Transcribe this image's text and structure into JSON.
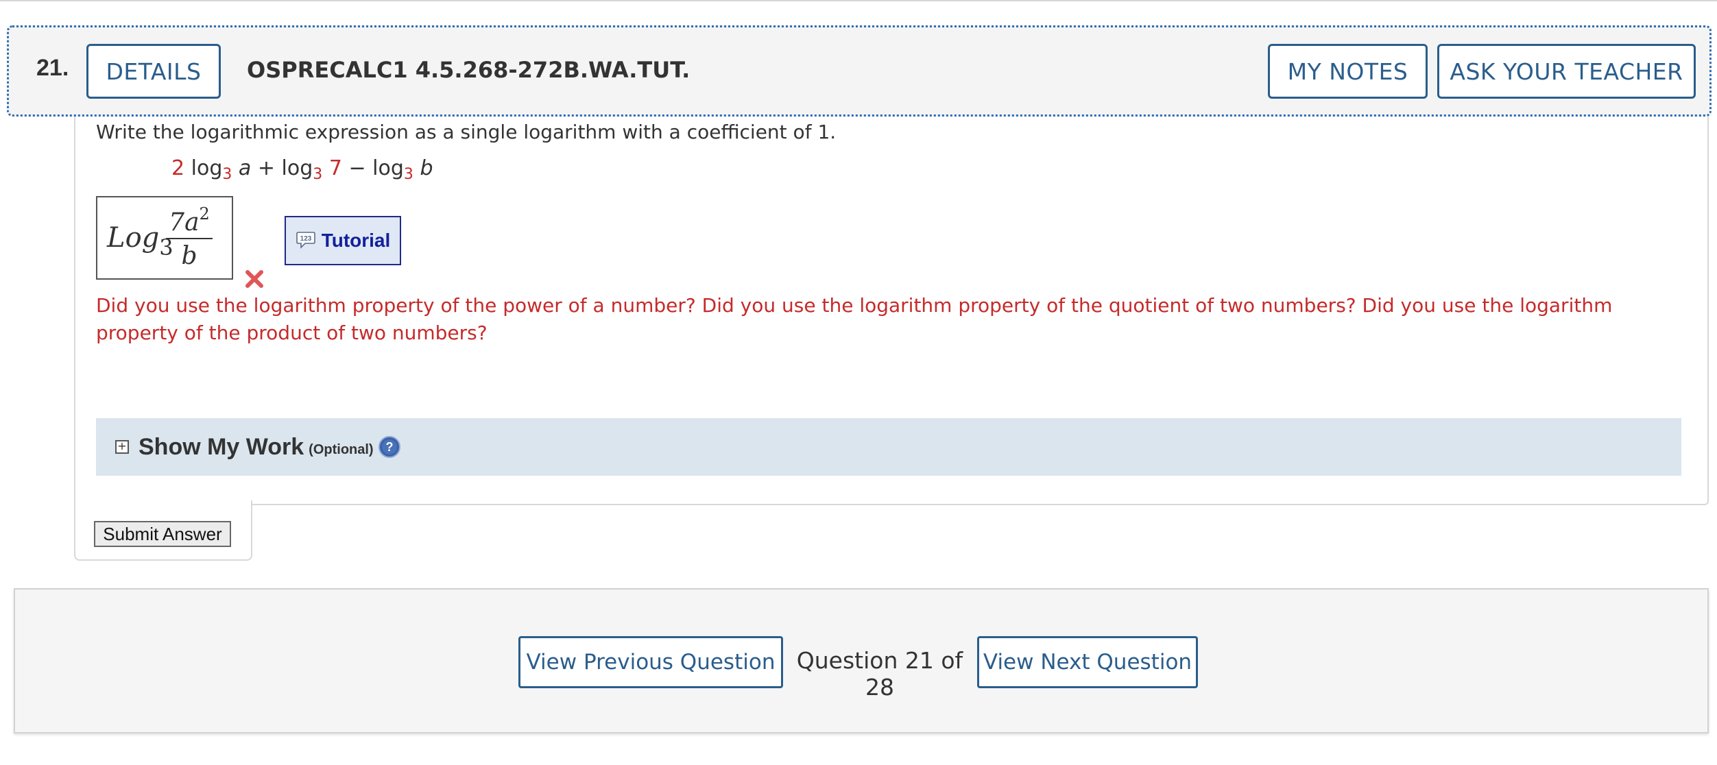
{
  "header": {
    "question_number": "21.",
    "details_label": "DETAILS",
    "question_code": "OSPRECALC1 4.5.268-272B.WA.TUT.",
    "my_notes_label": "MY NOTES",
    "ask_teacher_label": "ASK YOUR TEACHER"
  },
  "question": {
    "instructions": "Write the logarithmic expression as a single logarithm with a coefficient of 1.",
    "expression": {
      "coef": "2",
      "log1": "log",
      "base1": "3",
      "var1": "a",
      "plus": "+",
      "log2": "log",
      "base2": "3",
      "arg2": "7",
      "minus": "−",
      "log3": "log",
      "base3": "3",
      "var3": "b"
    }
  },
  "answer": {
    "log_text": "Log",
    "base": "3",
    "numerator": "7a",
    "exponent": "2",
    "denominator": "b",
    "status": "incorrect",
    "mark_color": "#e05555"
  },
  "tutorial": {
    "label": "Tutorial",
    "icon_text": "123"
  },
  "feedback": {
    "text": "Did you use the logarithm property of the power of a number? Did you use the logarithm property of the quotient of two numbers? Did you use the logarithm property of the product of two numbers?",
    "color": "#c62a2a"
  },
  "show_my_work": {
    "toggle": "+",
    "title": "Show My Work",
    "optional": "(Optional)",
    "help_icon": "question-mark-icon"
  },
  "submit": {
    "label": "Submit Answer"
  },
  "navigation": {
    "prev_label": "View Previous Question",
    "counter": "Question 21 of 28",
    "next_label": "View Next Question"
  },
  "colors": {
    "accent": "#2a5d8c",
    "focus_outline": "#2d6cb0",
    "error": "#c62a2a",
    "tutorial_text": "#13209a"
  }
}
